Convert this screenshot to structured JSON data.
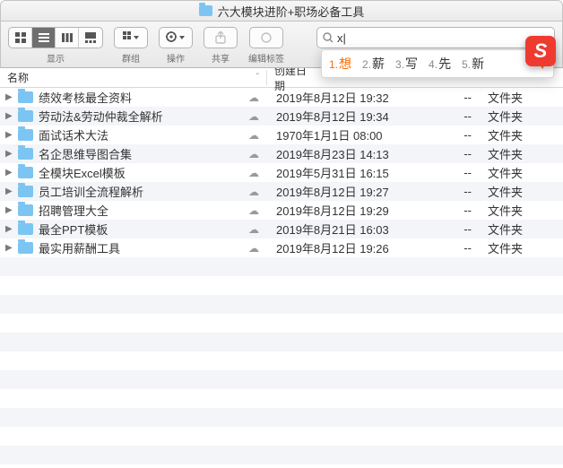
{
  "title": "六大模块进阶+职场必备工具",
  "toolbar": {
    "view_label": "显示",
    "group_label": "群组",
    "action_label": "操作",
    "share_label": "共享",
    "tags_label": "编辑标签"
  },
  "search": {
    "query": "x",
    "cursor": "|"
  },
  "ime": {
    "candidates": [
      {
        "n": "1.",
        "t": "想"
      },
      {
        "n": "2.",
        "t": "薪"
      },
      {
        "n": "3.",
        "t": "写"
      },
      {
        "n": "4.",
        "t": "先"
      },
      {
        "n": "5.",
        "t": "新"
      }
    ],
    "logo": "S"
  },
  "columns": {
    "name": "名称",
    "date": "创建日期",
    "sort_indicator": "ˆ"
  },
  "rows": [
    {
      "name": "绩效考核最全资料",
      "date": "2019年8月12日 19:32",
      "size": "--",
      "kind": "文件夹"
    },
    {
      "name": "劳动法&劳动仲裁全解析",
      "date": "2019年8月12日 19:34",
      "size": "--",
      "kind": "文件夹"
    },
    {
      "name": "面试话术大法",
      "date": "1970年1月1日 08:00",
      "size": "--",
      "kind": "文件夹"
    },
    {
      "name": "名企思维导图合集",
      "date": "2019年8月23日 14:13",
      "size": "--",
      "kind": "文件夹"
    },
    {
      "name": "全模块Excel模板",
      "date": "2019年5月31日 16:15",
      "size": "--",
      "kind": "文件夹"
    },
    {
      "name": "员工培训全流程解析",
      "date": "2019年8月12日 19:27",
      "size": "--",
      "kind": "文件夹"
    },
    {
      "name": "招聘管理大全",
      "date": "2019年8月12日 19:29",
      "size": "--",
      "kind": "文件夹"
    },
    {
      "name": "最全PPT模板",
      "date": "2019年8月21日 16:03",
      "size": "--",
      "kind": "文件夹"
    },
    {
      "name": "最实用薪酬工具",
      "date": "2019年8月12日 19:26",
      "size": "--",
      "kind": "文件夹"
    }
  ],
  "glyphs": {
    "triangle": "▶",
    "cloud": "☁"
  }
}
